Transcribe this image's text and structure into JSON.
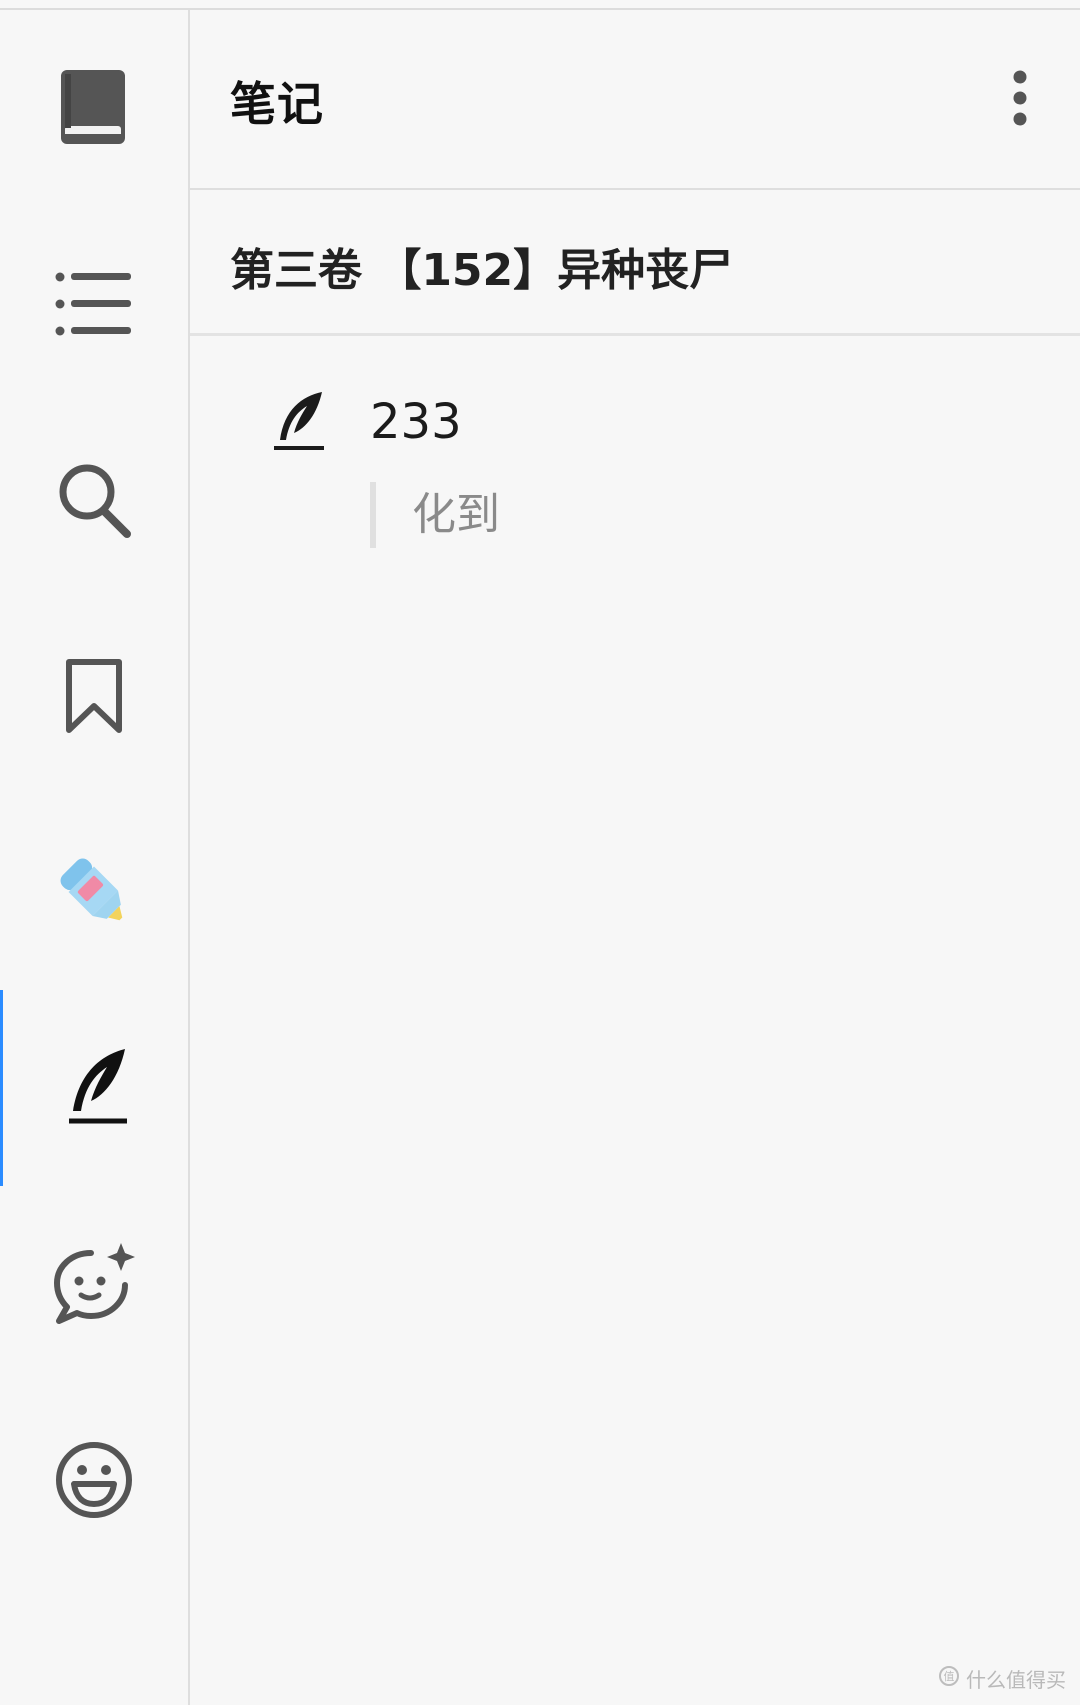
{
  "sidebar": {
    "items": [
      {
        "name": "book",
        "icon": "book-icon"
      },
      {
        "name": "table-of-contents",
        "icon": "list-icon"
      },
      {
        "name": "search",
        "icon": "search-icon"
      },
      {
        "name": "bookmarks",
        "icon": "bookmark-icon"
      },
      {
        "name": "highlights",
        "icon": "highlighter-icon"
      },
      {
        "name": "notes",
        "icon": "quill-icon",
        "active": true
      },
      {
        "name": "comments",
        "icon": "chat-sparkle-icon"
      },
      {
        "name": "emoji",
        "icon": "smiley-icon"
      }
    ],
    "active_color": "#2b8cff"
  },
  "header": {
    "title": "笔记",
    "more_icon": "more-vertical-icon"
  },
  "chapter": {
    "title": "第三卷 【152】异种丧尸"
  },
  "notes": [
    {
      "icon": "quill-icon",
      "text": "233",
      "quote": "化到"
    }
  ],
  "watermark": {
    "text": "什么值得买",
    "icon": "watermark-logo-icon"
  }
}
